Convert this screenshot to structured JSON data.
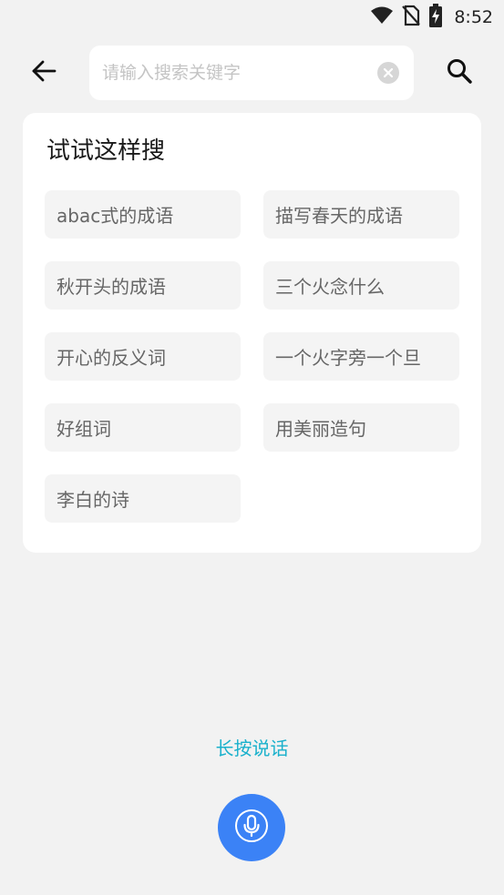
{
  "status_bar": {
    "time": "8:52",
    "icons": [
      "wifi-icon",
      "no-sim-icon",
      "battery-charging-icon"
    ]
  },
  "search": {
    "placeholder": "请输入搜索关键字",
    "value": ""
  },
  "suggestions": {
    "title": "试试这样搜",
    "items": [
      "abac式的成语",
      "描写春天的成语",
      "秋开头的成语",
      "三个火念什么",
      "开心的反义词",
      "一个火字旁一个旦",
      "好组词",
      "用美丽造句",
      "李白的诗"
    ]
  },
  "voice": {
    "label": "长按说话"
  },
  "colors": {
    "accent_blue": "#3b82f6",
    "voice_text": "#1ab1cc",
    "background": "#f2f2f2",
    "card": "#ffffff",
    "chip": "#f4f4f4"
  }
}
